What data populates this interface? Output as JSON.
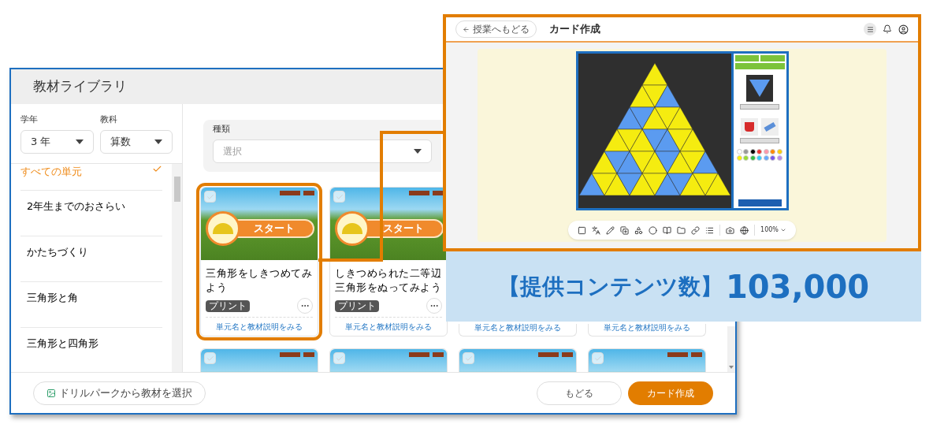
{
  "library_window": {
    "title": "教材ライブラリ",
    "filters": [
      {
        "label": "学年",
        "value": "3 年"
      },
      {
        "label": "教科",
        "value": "算数"
      }
    ],
    "units": [
      {
        "label": "すべての単元",
        "selected": true
      },
      {
        "label": "2年生までのおさらい",
        "selected": false
      },
      {
        "label": "かたちづくり",
        "selected": false
      },
      {
        "label": "三角形と角",
        "selected": false
      },
      {
        "label": "三角形と四角形",
        "selected": false
      }
    ],
    "type_filter": {
      "label": "種類",
      "placeholder": "選択"
    },
    "cards": [
      {
        "start_label": "スタート",
        "title": "三角形をしきつめてみよう",
        "tag": "プリント",
        "link": "単元名と教材説明をみる",
        "checked": false,
        "highlighted": true
      },
      {
        "start_label": "スタート",
        "title": "しきつめられた二等辺三角形をぬってみよう",
        "tag": "プリント",
        "link": "単元名と教材説明をみる",
        "checked": false,
        "highlighted": false
      },
      {
        "link": "単元名と教材説明をみる"
      },
      {
        "link": "単元名と教材説明をみる"
      },
      {
        "checked": false,
        "highlighted": false
      },
      {
        "checked": false,
        "highlighted": false
      },
      {
        "checked": false,
        "highlighted": false
      },
      {
        "checked": false,
        "highlighted": false
      }
    ],
    "footer": {
      "drill_button": "ドリルパークから教材を選択",
      "back_button": "もどる",
      "create_button": "カード作成"
    }
  },
  "card_window": {
    "back_button": "授業へもどる",
    "title": "カード作成",
    "zoom": "100%"
  },
  "banner": {
    "label": "【提供コンテンツ数】",
    "value": "103,000"
  }
}
